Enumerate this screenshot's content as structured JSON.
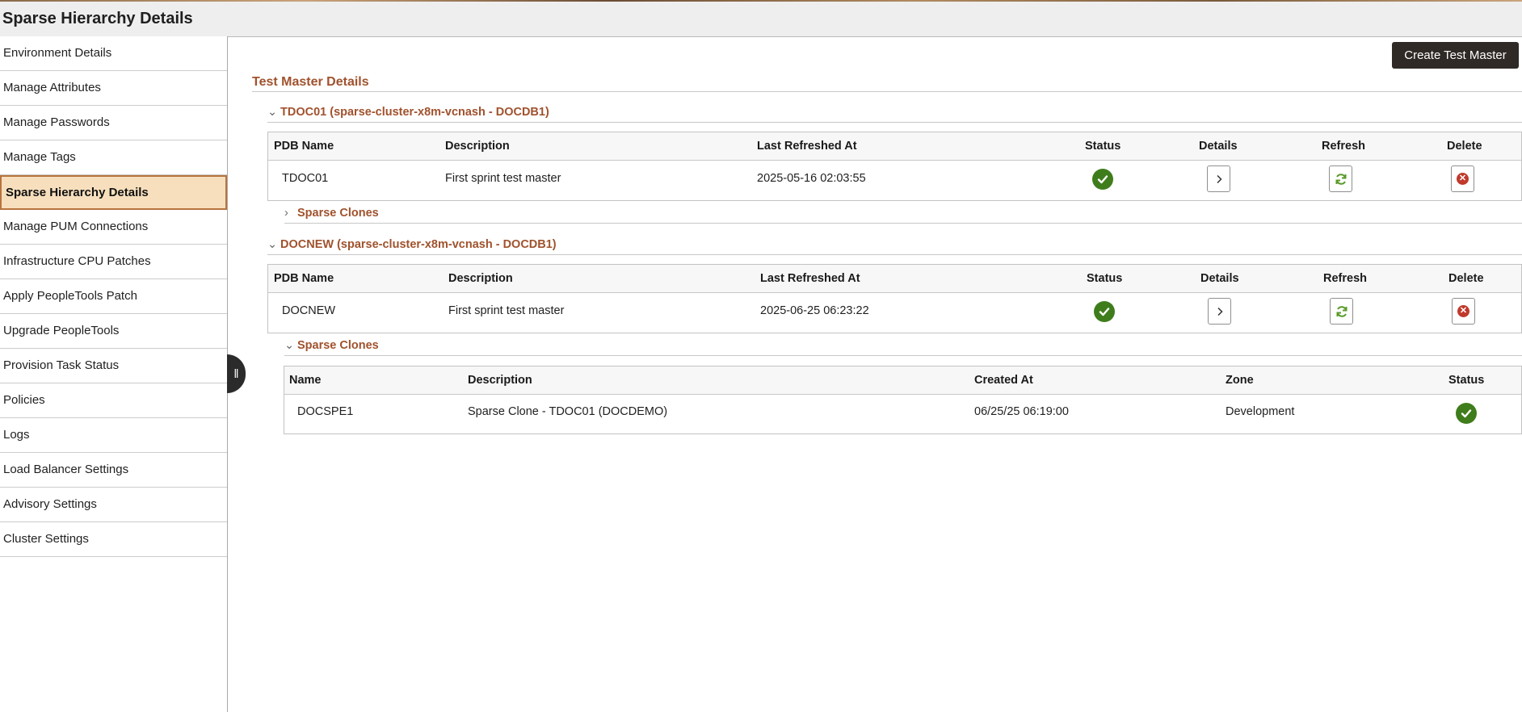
{
  "page_title": "Sparse Hierarchy Details",
  "sidebar": {
    "items": [
      {
        "label": "Environment Details"
      },
      {
        "label": "Manage Attributes"
      },
      {
        "label": "Manage Passwords"
      },
      {
        "label": "Manage Tags"
      },
      {
        "label": "Sparse Hierarchy Details",
        "active": true
      },
      {
        "label": "Manage PUM Connections"
      },
      {
        "label": "Infrastructure CPU Patches"
      },
      {
        "label": "Apply PeopleTools Patch"
      },
      {
        "label": "Upgrade PeopleTools"
      },
      {
        "label": "Provision Task Status"
      },
      {
        "label": "Policies"
      },
      {
        "label": "Logs"
      },
      {
        "label": "Load Balancer Settings"
      },
      {
        "label": "Advisory Settings"
      },
      {
        "label": "Cluster Settings"
      }
    ]
  },
  "toolbar": {
    "create_label": "Create Test Master"
  },
  "main": {
    "section_title": "Test Master Details",
    "columns": [
      "PDB Name",
      "Description",
      "Last Refreshed At",
      "Status",
      "Details",
      "Refresh",
      "Delete"
    ],
    "clone_columns": [
      "Name",
      "Description",
      "Created At",
      "Zone",
      "Status"
    ],
    "groups": [
      {
        "header": "TDOC01 (sparse-cluster-x8m-vcnash - DOCDB1)",
        "expanded": true,
        "row": {
          "pdb_name": "TDOC01",
          "description": "First sprint test master",
          "last_refreshed": "2025-05-16 02:03:55",
          "status": "ok"
        },
        "clones_label": "Sparse Clones",
        "clones_expanded": false,
        "clones": []
      },
      {
        "header": "DOCNEW (sparse-cluster-x8m-vcnash - DOCDB1)",
        "expanded": true,
        "row": {
          "pdb_name": "DOCNEW",
          "description": "First sprint test master",
          "last_refreshed": "2025-06-25 06:23:22",
          "status": "ok"
        },
        "clones_label": "Sparse Clones",
        "clones_expanded": true,
        "clones": [
          {
            "name": "DOCSPE1",
            "description": "Sparse Clone - TDOC01 (DOCDEMO)",
            "created_at": "06/25/25 06:19:00",
            "zone": "Development",
            "status": "ok"
          }
        ]
      }
    ]
  },
  "colors": {
    "accent": "#a0522d",
    "active_bg": "#f7dfbd",
    "success": "#3f7d1c",
    "danger": "#c0392b",
    "refresh": "#5a9a2a"
  },
  "icons": {
    "status": "check-circle-icon",
    "details": "chevron-right-icon",
    "refresh": "refresh-icon",
    "delete": "x-circle-icon",
    "collapse": "collapse-handle-icon"
  }
}
